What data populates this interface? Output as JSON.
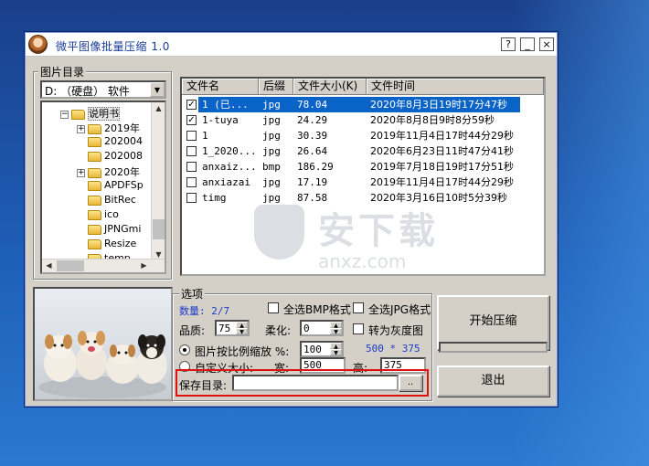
{
  "window": {
    "title": "微平图像批量压缩 1.0",
    "buttons": {
      "help": "?",
      "minimize": "_",
      "close": "×"
    }
  },
  "left_panel": {
    "group_label": "图片目录",
    "drive_combo": "D: （硬盘） 软件",
    "tree": [
      {
        "label": "说明书",
        "expander": "−",
        "level": 1
      },
      {
        "label": "2019年",
        "expander": "+",
        "level": 2
      },
      {
        "label": "202004",
        "expander": "",
        "level": 2
      },
      {
        "label": "202008",
        "expander": "",
        "level": 2
      },
      {
        "label": "2020年",
        "expander": "+",
        "level": 2
      },
      {
        "label": "APDFSp",
        "expander": "",
        "level": 2
      },
      {
        "label": "BitRec",
        "expander": "",
        "level": 2
      },
      {
        "label": "ico",
        "expander": "",
        "level": 2
      },
      {
        "label": "JPNGmi",
        "expander": "",
        "level": 2
      },
      {
        "label": "Resize",
        "expander": "",
        "level": 2
      },
      {
        "label": "temp",
        "expander": "",
        "level": 2
      }
    ]
  },
  "file_list": {
    "columns": [
      "文件名",
      "后缀",
      "文件大小(K)",
      "文件时间"
    ],
    "rows": [
      {
        "name": "1 (已...",
        "ext": "jpg",
        "size": "78.04",
        "time": "2020年8月3日19时17分47秒",
        "checked": true,
        "selected": true
      },
      {
        "name": "1-tuya",
        "ext": "jpg",
        "size": "24.29",
        "time": "2020年8月8日9时8分59秒",
        "checked": true,
        "selected": false
      },
      {
        "name": "1",
        "ext": "jpg",
        "size": "30.39",
        "time": "2019年11月4日17时44分29秒",
        "checked": false,
        "selected": false
      },
      {
        "name": "1_2020...",
        "ext": "jpg",
        "size": "26.64",
        "time": "2020年6月23日11时47分41秒",
        "checked": false,
        "selected": false
      },
      {
        "name": "anxaiz...",
        "ext": "bmp",
        "size": "186.29",
        "time": "2019年7月18日19时17分51秒",
        "checked": false,
        "selected": false
      },
      {
        "name": "anxiazai",
        "ext": "jpg",
        "size": "17.19",
        "time": "2019年11月4日17时44分29秒",
        "checked": false,
        "selected": false
      },
      {
        "name": "timg",
        "ext": "jpg",
        "size": "87.58",
        "time": "2020年3月16日10时5分39秒",
        "checked": false,
        "selected": false
      }
    ]
  },
  "watermark": {
    "text": "安下载",
    "sub": "anxz.com"
  },
  "options": {
    "group_label": "选项",
    "count_label": "数量: 2/7",
    "select_all_bmp": "全选BMP格式",
    "select_all_jpg": "全选JPG格式",
    "quality_label": "品质:",
    "quality_value": "75",
    "soften_label": "柔化:",
    "soften_value": "0",
    "grayscale_label": "转为灰度图",
    "scale_label": "图片按比例缩放 %:",
    "scale_value": "100",
    "dimensions_display": "500 * 375",
    "custom_size_label": "自定义大小:",
    "width_label": "宽:",
    "width_value": "500",
    "height_label": "高:",
    "height_value": "375",
    "save_dir_label": "保存目录:",
    "save_dir_value": "",
    "browse_button": ".."
  },
  "actions": {
    "start": "开始压缩",
    "exit": "退出",
    "progress": 0
  },
  "colors": {
    "selection": "#0a64c8",
    "highlight_box": "#e01010",
    "count_text": "#1a3cc8"
  }
}
